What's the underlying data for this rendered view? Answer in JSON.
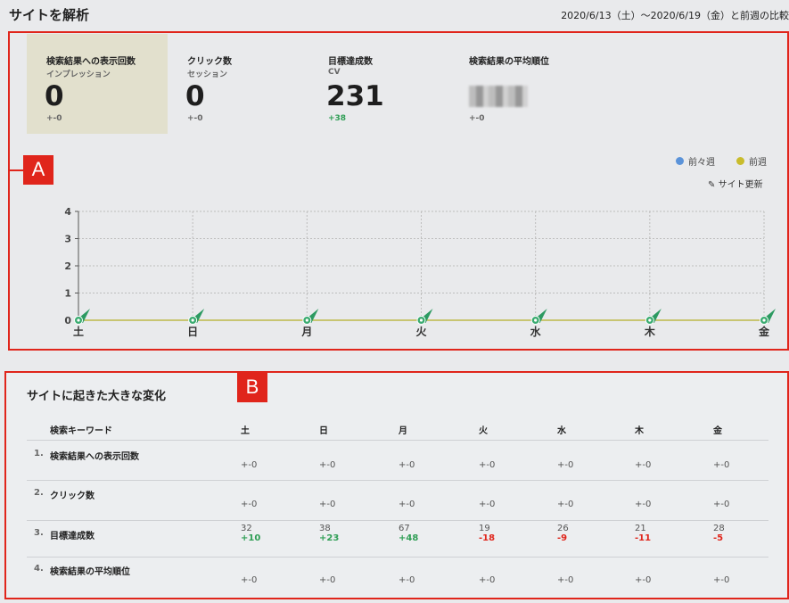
{
  "header": {
    "title": "サイトを解析",
    "date_range": "2020/6/13（土）〜2020/6/19（金）と前週の比較"
  },
  "annotations": {
    "a": "A",
    "b": "B"
  },
  "kpis": [
    {
      "title": "検索結果への表示回数",
      "sub": "インプレッション",
      "value": "0",
      "delta": "+-0"
    },
    {
      "title": "クリック数",
      "sub": "セッション",
      "value": "0",
      "delta": "+-0"
    },
    {
      "title": "目標達成数",
      "sub": "CV",
      "value": "231",
      "delta": "+38"
    },
    {
      "title": "検索結果の平均順位",
      "sub": "",
      "value": "",
      "delta": "+-0"
    }
  ],
  "legend": [
    {
      "label": "前々週",
      "color": "#5b93d9"
    },
    {
      "label": "前週",
      "color": "#c9bc2c"
    }
  ],
  "site_update_label": "サイト更新",
  "chart_data": {
    "type": "line",
    "categories": [
      "土",
      "日",
      "月",
      "火",
      "水",
      "木",
      "金"
    ],
    "series": [
      {
        "name": "前々週",
        "values": [
          0,
          0,
          0,
          0,
          0,
          0,
          0
        ],
        "color": "#5b93d9"
      },
      {
        "name": "前週",
        "values": [
          0,
          0,
          0,
          0,
          0,
          0,
          0
        ],
        "color": "#c9bc2c"
      }
    ],
    "yticks": [
      "0",
      "1",
      "2",
      "3",
      "4"
    ],
    "ylim": [
      0,
      4
    ],
    "grid": true,
    "markers": "site-update"
  },
  "changes": {
    "title": "サイトに起きた大きな変化",
    "columns": [
      "検索キーワード",
      "土",
      "日",
      "月",
      "火",
      "水",
      "木",
      "金"
    ],
    "rows": [
      {
        "num": "1.",
        "label": "検索結果への表示回数",
        "cells": [
          {
            "base": "",
            "delta": "+-0"
          },
          {
            "base": "",
            "delta": "+-0"
          },
          {
            "base": "",
            "delta": "+-0"
          },
          {
            "base": "",
            "delta": "+-0"
          },
          {
            "base": "",
            "delta": "+-0"
          },
          {
            "base": "",
            "delta": "+-0"
          },
          {
            "base": "",
            "delta": "+-0"
          }
        ]
      },
      {
        "num": "2.",
        "label": "クリック数",
        "cells": [
          {
            "base": "",
            "delta": "+-0"
          },
          {
            "base": "",
            "delta": "+-0"
          },
          {
            "base": "",
            "delta": "+-0"
          },
          {
            "base": "",
            "delta": "+-0"
          },
          {
            "base": "",
            "delta": "+-0"
          },
          {
            "base": "",
            "delta": "+-0"
          },
          {
            "base": "",
            "delta": "+-0"
          }
        ]
      },
      {
        "num": "3.",
        "label": "目標達成数",
        "cells": [
          {
            "base": "32",
            "delta": "+10"
          },
          {
            "base": "38",
            "delta": "+23"
          },
          {
            "base": "67",
            "delta": "+48"
          },
          {
            "base": "19",
            "delta": "-18"
          },
          {
            "base": "26",
            "delta": "-9"
          },
          {
            "base": "21",
            "delta": "-11"
          },
          {
            "base": "28",
            "delta": "-5"
          }
        ]
      },
      {
        "num": "4.",
        "label": "検索結果の平均順位",
        "cells": [
          {
            "base": "",
            "delta": "+-0"
          },
          {
            "base": "",
            "delta": "+-0"
          },
          {
            "base": "",
            "delta": "+-0"
          },
          {
            "base": "",
            "delta": "+-0"
          },
          {
            "base": "",
            "delta": "+-0"
          },
          {
            "base": "",
            "delta": "+-0"
          },
          {
            "base": "",
            "delta": "+-0"
          }
        ]
      }
    ]
  }
}
